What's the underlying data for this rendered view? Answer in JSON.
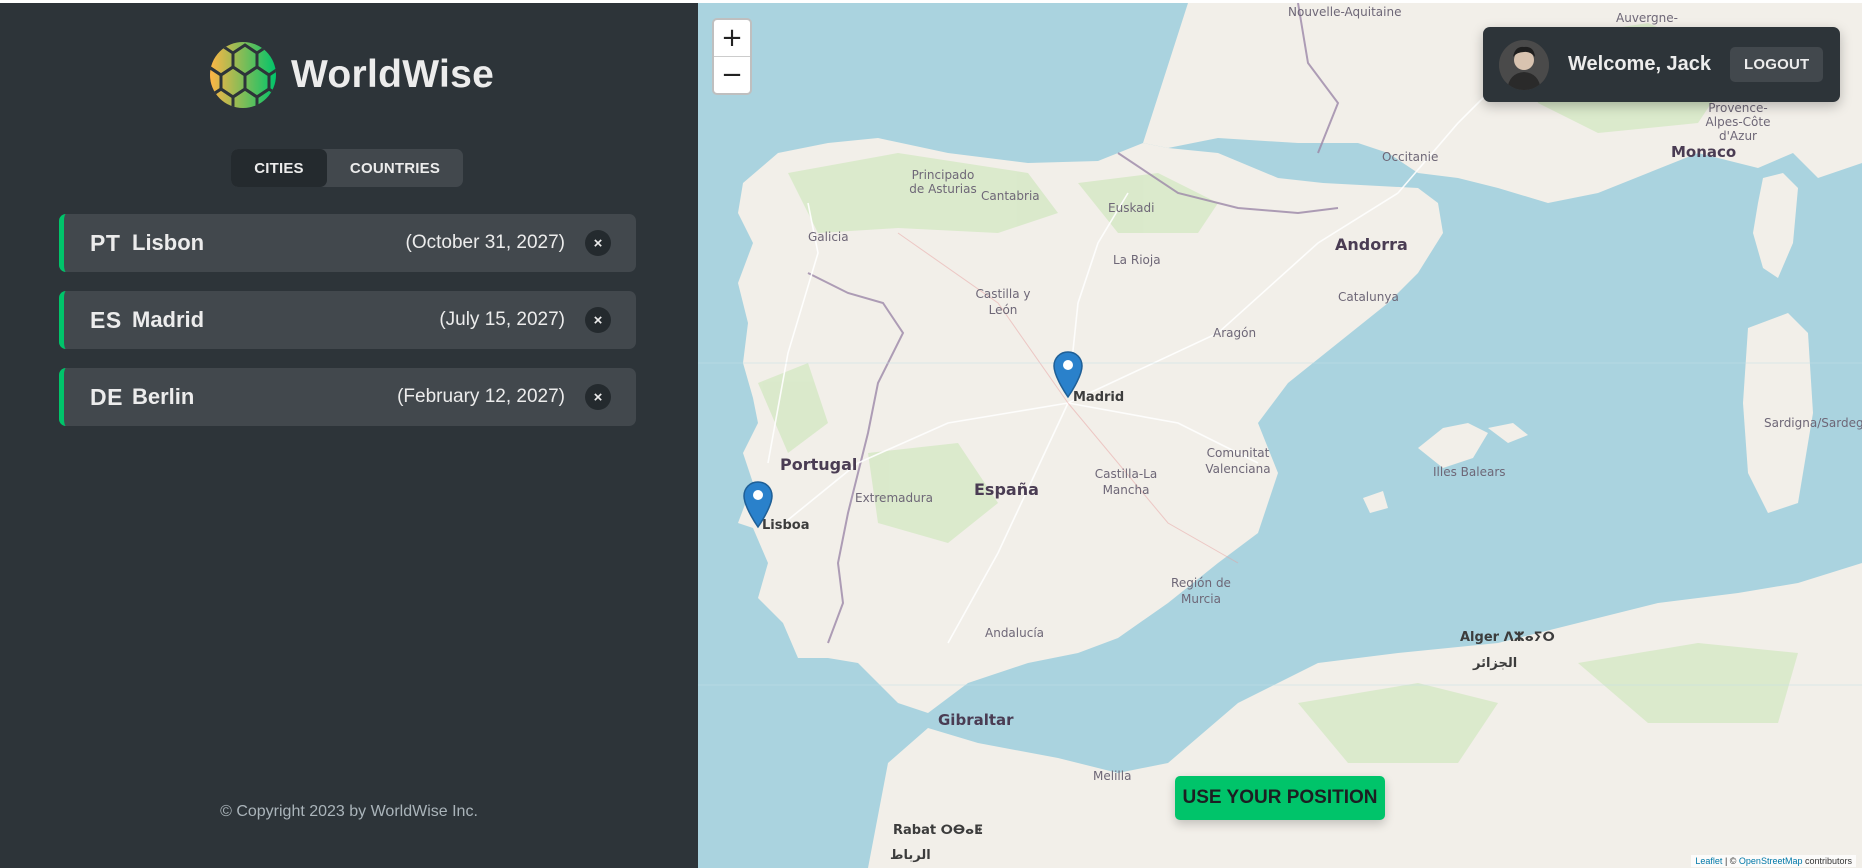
{
  "app": {
    "name": "WorldWise",
    "logo_colors": [
      "#ffb545",
      "#00c46a"
    ]
  },
  "tabs": [
    {
      "label": "CITIES",
      "active": true
    },
    {
      "label": "COUNTRIES",
      "active": false
    }
  ],
  "cities": [
    {
      "code": "PT",
      "name": "Lisbon",
      "date": "(October 31, 2027)",
      "delete_label": "×"
    },
    {
      "code": "ES",
      "name": "Madrid",
      "date": "(July 15, 2027)",
      "delete_label": "×"
    },
    {
      "code": "DE",
      "name": "Berlin",
      "date": "(February 12, 2027)",
      "delete_label": "×"
    }
  ],
  "footer": {
    "copyright": "© Copyright 2023 by WorldWise Inc."
  },
  "map": {
    "zoom_in": "+",
    "zoom_out": "−",
    "use_position_label": "USE YOUR POSITION",
    "attribution": {
      "leaflet": "Leaflet",
      "sep": " | © ",
      "osm": "OpenStreetMap",
      "suffix": " contributors"
    },
    "labels": {
      "nouvelle_aquitaine": "Nouvelle-Aquitaine",
      "auvergne": "Auvergne-",
      "provence": "Provence-Alpes-Côte d'Azur",
      "occitanie": "Occitanie",
      "monaco": "Monaco",
      "asturias": "Principado de Asturias",
      "cantabria": "Cantabria",
      "euskadi": "Euskadi",
      "galicia": "Galicia",
      "la_rioja": "La Rioja",
      "andorra": "Andorra",
      "castilla_leon": "Castilla y León",
      "catalunya": "Catalunya",
      "aragon": "Aragón",
      "madrid": "Madrid",
      "portugal": "Portugal",
      "espana": "España",
      "extremadura": "Extremadura",
      "castilla_mancha": "Castilla-La Mancha",
      "valenciana": "Comunitat Valenciana",
      "illes_balears": "Illes Balears",
      "sardegna": "Sardigna/Sardegna",
      "lisboa": "Lisboa",
      "murcia": "Región de Murcia",
      "andalucia": "Andalucía",
      "gibraltar": "Gibraltar",
      "alger": "Alger ⴷⵣⴰⵢⵔ",
      "alger_ar": "الجزائر",
      "melilla": "Melilla",
      "rabat": "Rabat ⵔⴱⴰⵟ",
      "rabat_ar": "الرباط"
    }
  },
  "user": {
    "welcome": "Welcome, Jack",
    "logout_label": "LOGOUT"
  },
  "colors": {
    "sidebar_bg": "#2d3439",
    "item_bg": "#42484d",
    "accent_green": "#00c46a",
    "text_light": "#ececec",
    "sea": "#aad3df",
    "land": "#f2efe9",
    "marker": "#2a81cb"
  }
}
